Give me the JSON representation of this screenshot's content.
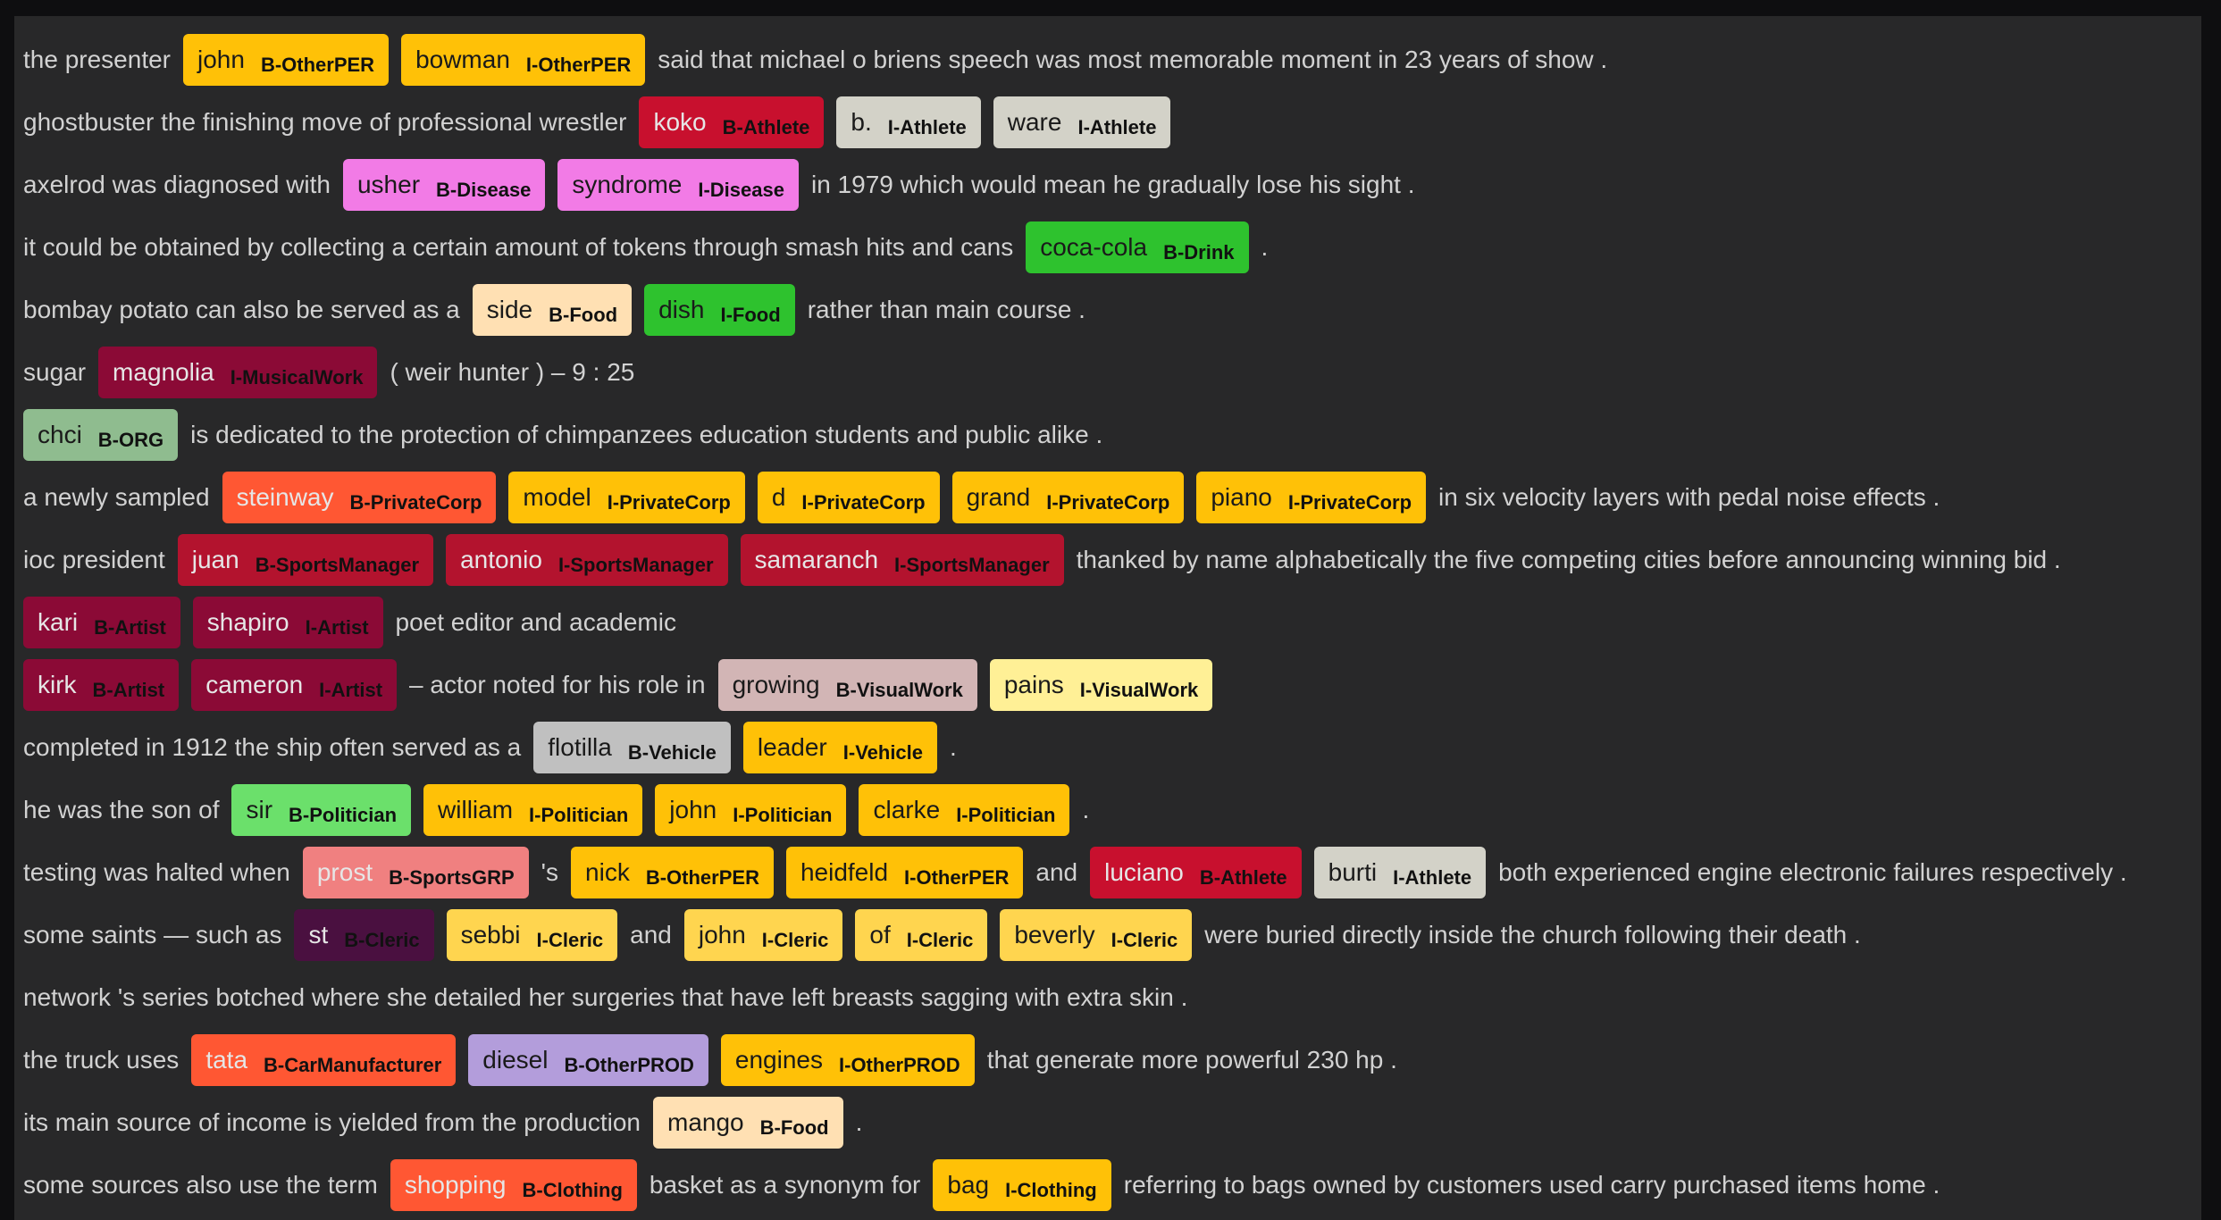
{
  "rows": [
    [
      {
        "t": "the presenter"
      },
      {
        "w": "john",
        "l": "B-OtherPER",
        "c": "#ffc107"
      },
      {
        "w": "bowman",
        "l": "I-OtherPER",
        "c": "#ffc107"
      },
      {
        "t": "said that michael o briens speech was most memorable moment in 23 years of show ."
      }
    ],
    [
      {
        "t": "ghostbuster the finishing move of professional wrestler"
      },
      {
        "w": "koko",
        "l": "B-Athlete",
        "c": "#c8102e",
        "d": true
      },
      {
        "w": "b.",
        "l": "I-Athlete",
        "c": "#d3d2c8"
      },
      {
        "w": "ware",
        "l": "I-Athlete",
        "c": "#d3d2c8"
      }
    ],
    [
      {
        "t": "axelrod was diagnosed with"
      },
      {
        "w": "usher",
        "l": "B-Disease",
        "c": "#f27be6"
      },
      {
        "w": "syndrome",
        "l": "I-Disease",
        "c": "#f27be6"
      },
      {
        "t": "in 1979 which would mean he gradually lose his sight ."
      }
    ],
    [
      {
        "t": "it could be obtained by collecting a certain amount of tokens through smash hits and cans"
      },
      {
        "w": "coca-cola",
        "l": "B-Drink",
        "c": "#2ec22e"
      },
      {
        "t": "."
      }
    ],
    [
      {
        "t": "bombay potato can also be served as a"
      },
      {
        "w": "side",
        "l": "B-Food",
        "c": "#ffe0b3"
      },
      {
        "w": "dish",
        "l": "I-Food",
        "c": "#2ec22e"
      },
      {
        "t": "rather than main course ."
      }
    ],
    [
      {
        "t": "sugar"
      },
      {
        "w": "magnolia",
        "l": "I-MusicalWork",
        "c": "#8b0a36",
        "d": true
      },
      {
        "t": "( weir hunter ) – 9 : 25"
      }
    ],
    [
      {
        "w": "chci",
        "l": "B-ORG",
        "c": "#8fbc8f"
      },
      {
        "t": "is dedicated to the protection of chimpanzees education students and public alike ."
      }
    ],
    [
      {
        "t": "a newly sampled"
      },
      {
        "w": "steinway",
        "l": "B-PrivateCorp",
        "c": "#ff5733",
        "d": true
      },
      {
        "w": "model",
        "l": "I-PrivateCorp",
        "c": "#ffc107"
      },
      {
        "w": "d",
        "l": "I-PrivateCorp",
        "c": "#ffc107"
      },
      {
        "w": "grand",
        "l": "I-PrivateCorp",
        "c": "#ffc107"
      },
      {
        "w": "piano",
        "l": "I-PrivateCorp",
        "c": "#ffc107"
      },
      {
        "t": "in six velocity layers with pedal noise effects ."
      }
    ],
    [
      {
        "t": "ioc president"
      },
      {
        "w": "juan",
        "l": "B-SportsManager",
        "c": "#b3132e",
        "d": true
      },
      {
        "w": "antonio",
        "l": "I-SportsManager",
        "c": "#b3132e",
        "d": true
      },
      {
        "w": "samaranch",
        "l": "I-SportsManager",
        "c": "#b3132e",
        "d": true
      },
      {
        "t": "thanked by name alphabetically the five competing cities before announcing winning bid ."
      }
    ],
    [
      {
        "w": "kari",
        "l": "B-Artist",
        "c": "#8b0a36",
        "d": true
      },
      {
        "w": "shapiro",
        "l": "I-Artist",
        "c": "#8b0a36",
        "d": true
      },
      {
        "t": "poet editor and academic"
      }
    ],
    [
      {
        "w": "kirk",
        "l": "B-Artist",
        "c": "#8b0a36",
        "d": true
      },
      {
        "w": "cameron",
        "l": "I-Artist",
        "c": "#8b0a36",
        "d": true
      },
      {
        "t": "– actor noted for his role in"
      },
      {
        "w": "growing",
        "l": "B-VisualWork",
        "c": "#d2b5b5"
      },
      {
        "w": "pains",
        "l": "I-VisualWork",
        "c": "#fff096"
      }
    ],
    [
      {
        "t": "completed in 1912 the ship often served as a"
      },
      {
        "w": "flotilla",
        "l": "B-Vehicle",
        "c": "#c0c0c0"
      },
      {
        "w": "leader",
        "l": "I-Vehicle",
        "c": "#ffc107"
      },
      {
        "t": "."
      }
    ],
    [
      {
        "t": "he was the son of"
      },
      {
        "w": "sir",
        "l": "B-Politician",
        "c": "#6be06b"
      },
      {
        "w": "william",
        "l": "I-Politician",
        "c": "#ffc107"
      },
      {
        "w": "john",
        "l": "I-Politician",
        "c": "#ffc107"
      },
      {
        "w": "clarke",
        "l": "I-Politician",
        "c": "#ffc107"
      },
      {
        "t": "."
      }
    ],
    [
      {
        "t": "testing was halted when"
      },
      {
        "w": "prost",
        "l": "B-SportsGRP",
        "c": "#f08080",
        "d": true
      },
      {
        "t": "'s"
      },
      {
        "w": "nick",
        "l": "B-OtherPER",
        "c": "#ffc107"
      },
      {
        "w": "heidfeld",
        "l": "I-OtherPER",
        "c": "#ffc107"
      },
      {
        "t": "and"
      },
      {
        "w": "luciano",
        "l": "B-Athlete",
        "c": "#c8102e",
        "d": true
      },
      {
        "w": "burti",
        "l": "I-Athlete",
        "c": "#d3d2c8"
      },
      {
        "t": "both experienced engine electronic failures respectively ."
      }
    ],
    [
      {
        "t": "some saints — such as"
      },
      {
        "w": "st",
        "l": "B-Cleric",
        "c": "#4a1040",
        "d": true
      },
      {
        "w": "sebbi",
        "l": "I-Cleric",
        "c": "#ffd54f"
      },
      {
        "t": "and"
      },
      {
        "w": "john",
        "l": "I-Cleric",
        "c": "#ffd54f"
      },
      {
        "w": "of",
        "l": "I-Cleric",
        "c": "#ffd54f"
      },
      {
        "w": "beverly",
        "l": "I-Cleric",
        "c": "#ffd54f"
      },
      {
        "t": "were buried directly inside the church following their death ."
      }
    ],
    [
      {
        "t": "network 's series botched where she detailed her surgeries that have left breasts sagging with extra skin ."
      }
    ],
    [
      {
        "t": "the truck uses"
      },
      {
        "w": "tata",
        "l": "B-CarManufacturer",
        "c": "#ff5733",
        "d": true
      },
      {
        "w": "diesel",
        "l": "B-OtherPROD",
        "c": "#b39ddb"
      },
      {
        "w": "engines",
        "l": "I-OtherPROD",
        "c": "#ffc107"
      },
      {
        "t": "that generate more powerful 230 hp ."
      }
    ],
    [
      {
        "t": "its main source of income is yielded from the production"
      },
      {
        "w": "mango",
        "l": "B-Food",
        "c": "#ffe0b3"
      },
      {
        "t": "."
      }
    ],
    [
      {
        "t": "some sources also use the term"
      },
      {
        "w": "shopping",
        "l": "B-Clothing",
        "c": "#ff5733",
        "d": true
      },
      {
        "t": "basket as a synonym for"
      },
      {
        "w": "bag",
        "l": "I-Clothing",
        "c": "#ffc107"
      },
      {
        "t": "referring to bags owned by customers used carry purchased items home ."
      }
    ]
  ]
}
